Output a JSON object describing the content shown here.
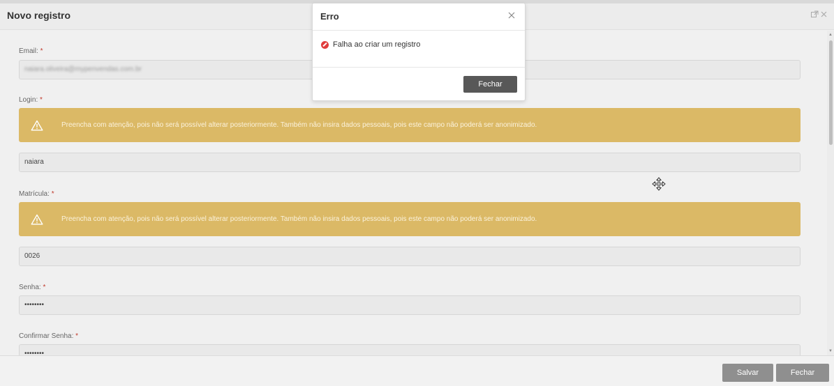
{
  "window": {
    "title": "Novo registro",
    "header_icons": [
      "external-icon",
      "close-icon"
    ]
  },
  "form": {
    "required_marker": "*",
    "email": {
      "label": "Email:",
      "value": "naiara.oliveira@mypenvendas.com.br"
    },
    "login": {
      "label": "Login:",
      "value": "naiara",
      "warning": "Preencha com atenção, pois não será possível alterar posteriormente. Também não insira dados pessoais, pois este campo não poderá ser anonimizado."
    },
    "matricula": {
      "label": "Matrícula:",
      "value": "0026",
      "warning": "Preencha com atenção, pois não será possível alterar posteriormente. Também não insira dados pessoais, pois este campo não poderá ser anonimizado."
    },
    "senha": {
      "label": "Senha:",
      "value": "••••••••"
    },
    "confirmar_senha": {
      "label": "Confirmar Senha:",
      "value": "••••••••"
    }
  },
  "footer": {
    "save_label": "Salvar",
    "close_label": "Fechar"
  },
  "modal": {
    "title": "Erro",
    "message": "Falha ao criar um registro",
    "close_button_label": "Fechar"
  },
  "colors": {
    "warning_bg": "#dbb966",
    "error_icon": "#e03c3c",
    "button_gray": "#8f8f8f",
    "modal_button": "#585858"
  }
}
